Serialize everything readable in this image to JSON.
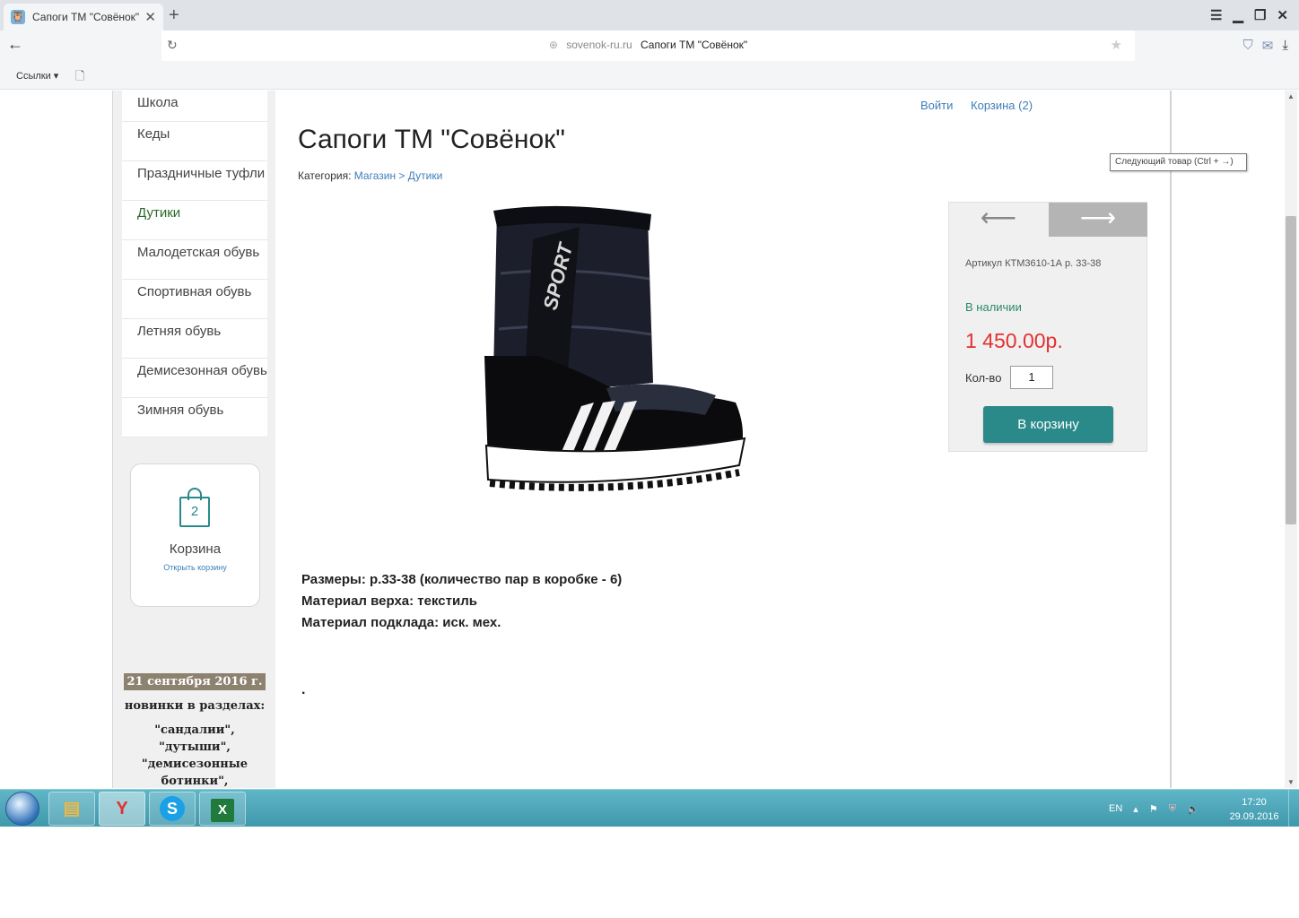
{
  "browser": {
    "tab_title": "Сапоги ТМ \"Совёнок\"",
    "tab_close": "✕",
    "new_tab": "+",
    "host": "sovenok-ru.ru",
    "page_title_in_omnibox": "Сапоги ТМ \"Совёнок\"",
    "bookmarks_label": "Ссылки ▾"
  },
  "sidebar": {
    "items": [
      {
        "label": "Школа"
      },
      {
        "label": "Кеды"
      },
      {
        "label": "Праздничные туфли"
      },
      {
        "label": "Дутики"
      },
      {
        "label": "Малодетская обувь"
      },
      {
        "label": "Спортивная обувь"
      },
      {
        "label": "Летняя обувь"
      },
      {
        "label": "Демисезонная обувь"
      },
      {
        "label": "Зимняя обувь"
      }
    ],
    "active_item": "Дутики",
    "cart": {
      "count": "2",
      "title": "Корзина",
      "open_link": "Открыть корзину"
    },
    "news": {
      "date": "21 сентября 2016 г.",
      "line1": "новинки в разделах:",
      "line2": "\"сандалии\", \"дутыши\", \"демисезонные ботинки\", \"праздничные туфли\","
    }
  },
  "header": {
    "login": "Войти",
    "cart": "Корзина (2)"
  },
  "product": {
    "title": "Сапоги ТМ \"Совёнок\"",
    "category_label": "Категория:",
    "category_path": "Магазин > Дутики",
    "image_text": "SPORT",
    "description": [
      "Размеры: р.33-38 (количество пар в коробке - 6)",
      "Материал верха: текстиль",
      "Материал подклада: иск. мех."
    ],
    "trailing_dot": "."
  },
  "buybox": {
    "prev_arrow": "⟵",
    "next_arrow": "⟶",
    "tooltip": "Следующий товар (Ctrl + →)",
    "sku": "Артикул КТМ3610-1А р. 33-38",
    "availability": "В наличии",
    "price": "1 450.00р.",
    "qty_label": "Кол-во",
    "qty_value": "1",
    "buy_button": "В корзину"
  },
  "taskbar": {
    "lang": "EN",
    "time": "17:20",
    "date": "29.09.2016"
  },
  "colors": {
    "accent": "#2a8a8a",
    "price": "#e53030",
    "link": "#3d7fb8",
    "taskbar": "#4fa7b9"
  }
}
